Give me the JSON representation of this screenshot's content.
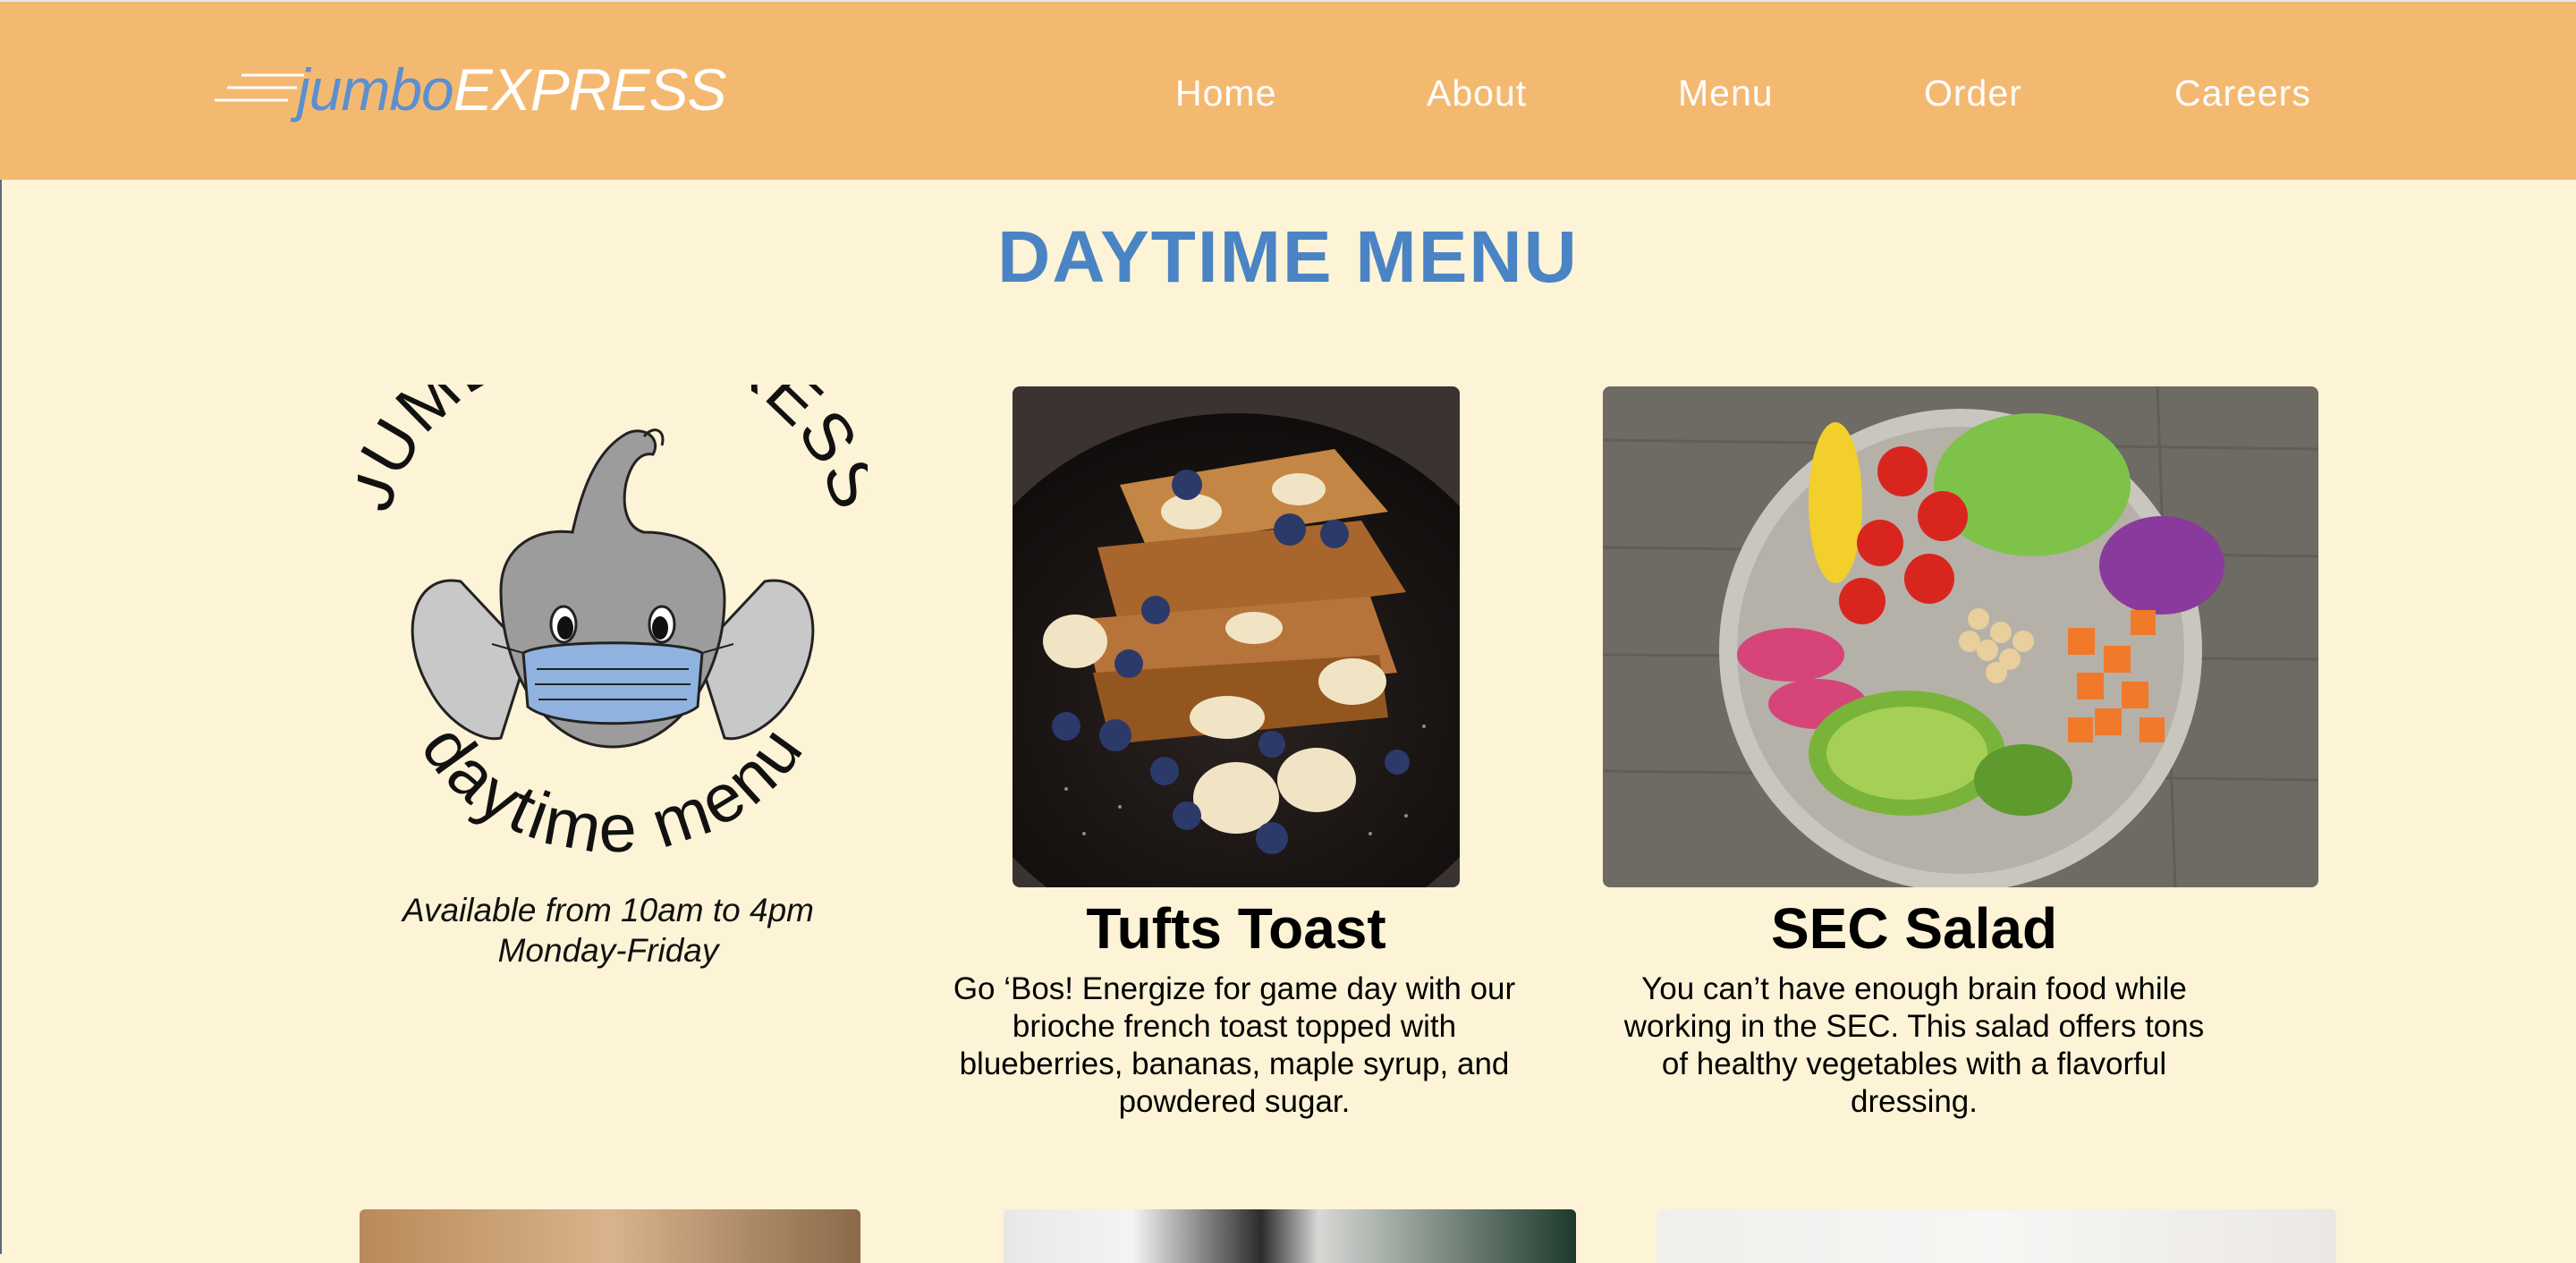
{
  "brand": {
    "name_part1": "jumbo",
    "name_part2": "EXPRESS",
    "colors": {
      "header": "#f4b971",
      "accent": "#4a84c4",
      "background": "#fdf3d6"
    }
  },
  "nav": {
    "items": [
      {
        "label": "Home"
      },
      {
        "label": "About"
      },
      {
        "label": "Menu"
      },
      {
        "label": "Order"
      },
      {
        "label": "Careers"
      }
    ]
  },
  "page": {
    "title": "DAYTIME MENU"
  },
  "badge": {
    "top_text": "JUMBO EXPRESS",
    "bottom_text": "daytime menu",
    "availability_line1": "Available from 10am to 4pm",
    "availability_line2": "Monday-Friday"
  },
  "items": [
    {
      "title": "Tufts Toast",
      "description": "Go ‘Bos! Energize for game day with our brioche french toast topped with blueberries, bananas, maple syrup, and powdered sugar."
    },
    {
      "title": "SEC Salad",
      "description": "You can’t have enough brain food while working in the SEC. This salad offers tons of healthy vegetables with a flavorful dressing."
    }
  ]
}
